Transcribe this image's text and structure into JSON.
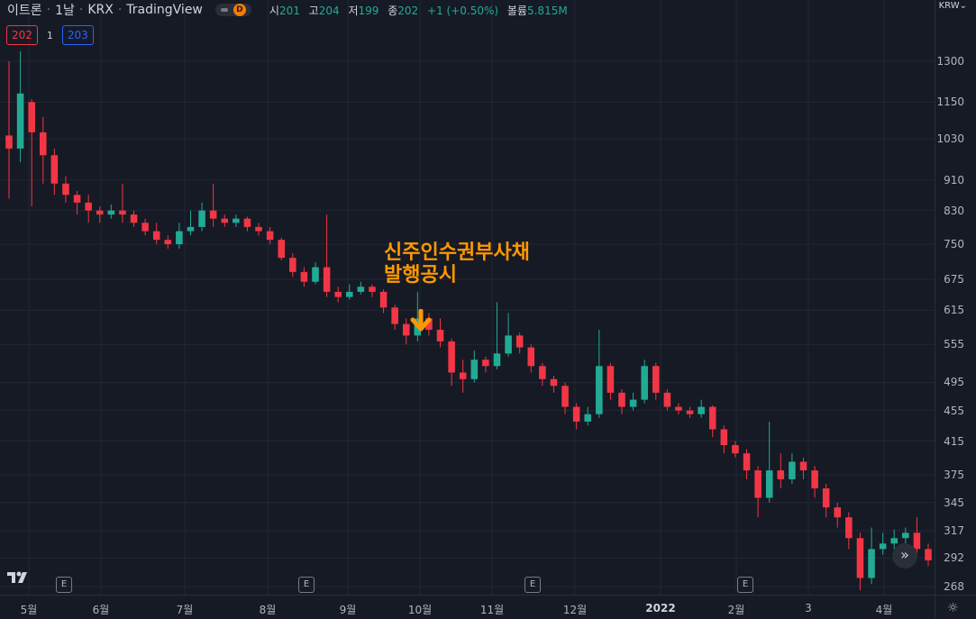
{
  "header": {
    "symbol": "이트론",
    "interval": "1날",
    "exchange": "KRX",
    "source": "TradingView",
    "toggle_badge": "D",
    "ohlc": {
      "open_label": "시",
      "open": "201",
      "high_label": "고",
      "high": "204",
      "low_label": "저",
      "low": "199",
      "close_label": "종",
      "close": "202",
      "change": "+1 (+0.50%)",
      "volume_label": "볼륨",
      "volume": "5.815M"
    }
  },
  "trade": {
    "sell": "202",
    "qty": "1",
    "buy": "203"
  },
  "currency": "KRW",
  "annotation": {
    "line1": "신주인수권부사채",
    "line2": "발행공시"
  },
  "colors": {
    "up": "#22ab94",
    "down": "#f23645",
    "annotation": "#ff9800",
    "background": "#161a25",
    "grid": "#232735"
  },
  "icons": {
    "logo": "tradingview-logo-icon",
    "scroll": "double-chevron-right-icon",
    "settings": "gear-icon"
  },
  "chart_data": {
    "type": "candlestick",
    "y_scale": "log",
    "y_ticks": [
      1300,
      1150,
      1030,
      910,
      830,
      750,
      675,
      615,
      555,
      495,
      455,
      415,
      375,
      345,
      317,
      292,
      268
    ],
    "x_ticks": [
      "5월",
      "6월",
      "7월",
      "8월",
      "9월",
      "10월",
      "11월",
      "12월",
      "2022",
      "2월",
      "3",
      "4월"
    ],
    "earnings_markers": [
      "E",
      "E",
      "E",
      "E"
    ],
    "series": [
      [
        0,
        1040,
        1000,
        1300,
        860
      ],
      [
        1,
        1000,
        1180,
        1340,
        960
      ],
      [
        2,
        1150,
        1050,
        1160,
        840
      ],
      [
        3,
        1050,
        980,
        1100,
        900
      ],
      [
        4,
        980,
        900,
        1000,
        870
      ],
      [
        5,
        900,
        870,
        920,
        850
      ],
      [
        6,
        870,
        850,
        880,
        820
      ],
      [
        7,
        850,
        830,
        870,
        800
      ],
      [
        8,
        830,
        820,
        840,
        800
      ],
      [
        9,
        820,
        830,
        845,
        810
      ],
      [
        10,
        830,
        820,
        900,
        800
      ],
      [
        11,
        820,
        800,
        830,
        790
      ],
      [
        12,
        800,
        780,
        810,
        770
      ],
      [
        13,
        780,
        760,
        800,
        750
      ],
      [
        14,
        760,
        750,
        770,
        740
      ],
      [
        15,
        750,
        780,
        800,
        740
      ],
      [
        16,
        780,
        790,
        830,
        770
      ],
      [
        17,
        790,
        830,
        850,
        780
      ],
      [
        18,
        830,
        810,
        900,
        790
      ],
      [
        19,
        810,
        800,
        820,
        790
      ],
      [
        20,
        800,
        810,
        820,
        790
      ],
      [
        21,
        810,
        790,
        815,
        780
      ],
      [
        22,
        790,
        780,
        800,
        770
      ],
      [
        23,
        780,
        760,
        790,
        750
      ],
      [
        24,
        760,
        720,
        765,
        715
      ],
      [
        25,
        720,
        690,
        730,
        680
      ],
      [
        26,
        690,
        670,
        700,
        660
      ],
      [
        27,
        670,
        700,
        710,
        665
      ],
      [
        28,
        700,
        650,
        820,
        640
      ],
      [
        29,
        650,
        640,
        660,
        630
      ],
      [
        30,
        640,
        650,
        665,
        635
      ],
      [
        31,
        650,
        660,
        670,
        645
      ],
      [
        32,
        660,
        650,
        665,
        640
      ],
      [
        33,
        650,
        620,
        655,
        610
      ],
      [
        34,
        620,
        590,
        625,
        580
      ],
      [
        35,
        590,
        570,
        600,
        555
      ],
      [
        36,
        570,
        600,
        650,
        560
      ],
      [
        37,
        600,
        580,
        610,
        570
      ],
      [
        38,
        580,
        560,
        600,
        550
      ],
      [
        39,
        560,
        510,
        565,
        490
      ],
      [
        40,
        510,
        500,
        530,
        480
      ],
      [
        41,
        500,
        530,
        545,
        495
      ],
      [
        42,
        530,
        520,
        535,
        510
      ],
      [
        43,
        520,
        540,
        630,
        515
      ],
      [
        44,
        540,
        570,
        610,
        535
      ],
      [
        45,
        570,
        550,
        575,
        540
      ],
      [
        46,
        550,
        520,
        555,
        510
      ],
      [
        47,
        520,
        500,
        525,
        490
      ],
      [
        48,
        500,
        490,
        505,
        480
      ],
      [
        49,
        490,
        460,
        495,
        450
      ],
      [
        50,
        460,
        440,
        465,
        430
      ],
      [
        51,
        440,
        450,
        460,
        435
      ],
      [
        52,
        450,
        520,
        580,
        445
      ],
      [
        53,
        520,
        480,
        525,
        470
      ],
      [
        54,
        480,
        460,
        485,
        450
      ],
      [
        55,
        460,
        470,
        480,
        455
      ],
      [
        56,
        470,
        520,
        530,
        465
      ],
      [
        57,
        520,
        480,
        525,
        470
      ],
      [
        58,
        480,
        460,
        485,
        455
      ],
      [
        59,
        460,
        455,
        465,
        450
      ],
      [
        60,
        455,
        450,
        460,
        445
      ],
      [
        61,
        450,
        460,
        470,
        445
      ],
      [
        62,
        460,
        430,
        462,
        420
      ],
      [
        63,
        430,
        410,
        435,
        400
      ],
      [
        64,
        410,
        400,
        415,
        395
      ],
      [
        65,
        400,
        380,
        405,
        370
      ],
      [
        66,
        380,
        350,
        385,
        330
      ],
      [
        67,
        350,
        380,
        440,
        345
      ],
      [
        68,
        380,
        370,
        400,
        360
      ],
      [
        69,
        370,
        390,
        400,
        365
      ],
      [
        70,
        390,
        380,
        395,
        370
      ],
      [
        71,
        380,
        360,
        385,
        350
      ],
      [
        72,
        360,
        340,
        365,
        330
      ],
      [
        73,
        340,
        330,
        345,
        320
      ],
      [
        74,
        330,
        310,
        335,
        300
      ],
      [
        75,
        310,
        275,
        315,
        265
      ],
      [
        76,
        275,
        300,
        320,
        270
      ],
      [
        77,
        300,
        305,
        315,
        295
      ],
      [
        78,
        305,
        310,
        318,
        300
      ],
      [
        79,
        310,
        315,
        320,
        305
      ],
      [
        80,
        315,
        300,
        330,
        295
      ],
      [
        81,
        300,
        290,
        305,
        285
      ]
    ]
  }
}
